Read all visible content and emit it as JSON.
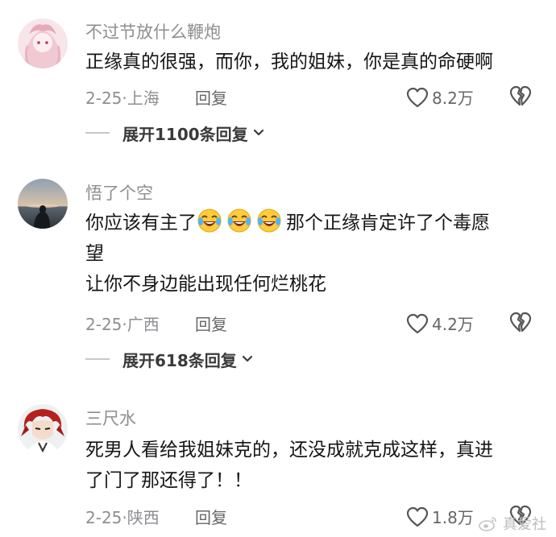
{
  "comments": [
    {
      "username": "不过节放什么鞭炮",
      "lines": [
        "正缘真的很强，而你，我的姐妹，你是真的命硬啊"
      ],
      "date": "2-25",
      "location": "上海",
      "reply_label": "回复",
      "likes": "8.2万",
      "expand_label": "展开1100条回复"
    },
    {
      "username": "悟了个空",
      "line1_prefix": "你应该有主了",
      "line1_suffix": "那个正缘肯定许了个毒愿",
      "line2": "望",
      "line3": "让你不身边能出现任何烂桃花",
      "date": "2-25",
      "location": "广西",
      "reply_label": "回复",
      "likes": "4.2万",
      "expand_label": "展开618条回复"
    },
    {
      "username": "三尺水",
      "lines": [
        "死男人看给我姐妹克的，还没成就克成这样，真进",
        "了门了那还得了！！"
      ],
      "date": "2-25",
      "location": "陕西",
      "reply_label": "回复",
      "likes": "1.8万"
    }
  ],
  "watermark": {
    "text": "真爱社",
    "icon": "weibo-logo-icon"
  },
  "icons": {
    "like": "heart-outline-icon",
    "dislike": "broken-heart-icon",
    "expand": "chevron-down-icon",
    "emoji": "laughing-crying-emoji-icon"
  }
}
